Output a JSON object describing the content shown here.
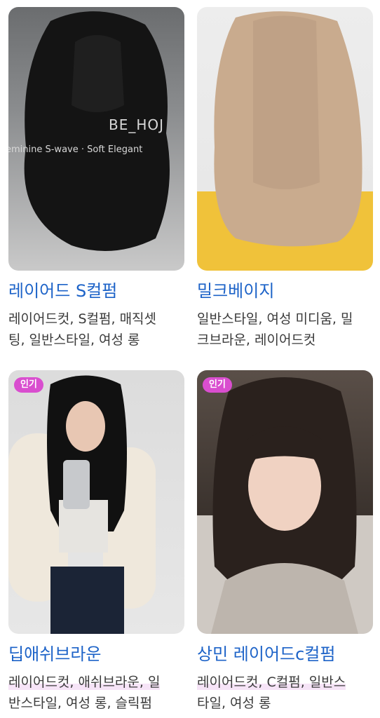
{
  "cards": [
    {
      "title": "레이어드 S컬펌",
      "tags_line1": "레이어드컷, S컬펌, 매직셋",
      "tags_line2": "팅, 일반스타일, 여성 롱",
      "badge": "",
      "photo_caption_1": "BE_HOJ",
      "photo_caption_2": "eminine S-wave · Soft Elegant"
    },
    {
      "title": "밀크베이지",
      "tags_line1": "일반스타일, 여성 미디움, 밀",
      "tags_line2": "크브라운, 레이어드컷",
      "badge": ""
    },
    {
      "title": "딥애쉬브라운",
      "tags_line1": "레이어드컷, 애쉬브라운, 일",
      "tags_line2": "반스타일, 여성 롱, 슬릭펌",
      "badge": "인기"
    },
    {
      "title": "상민 레이어드c컬펌",
      "tags_line1": "레이어드컷, C컬펌, 일반스",
      "tags_line2": "타일, 여성 롱",
      "badge": "인기"
    }
  ],
  "colors": {
    "title": "#1d63c8",
    "badge": "#d94ecf",
    "tags": "#3a3a3a"
  }
}
